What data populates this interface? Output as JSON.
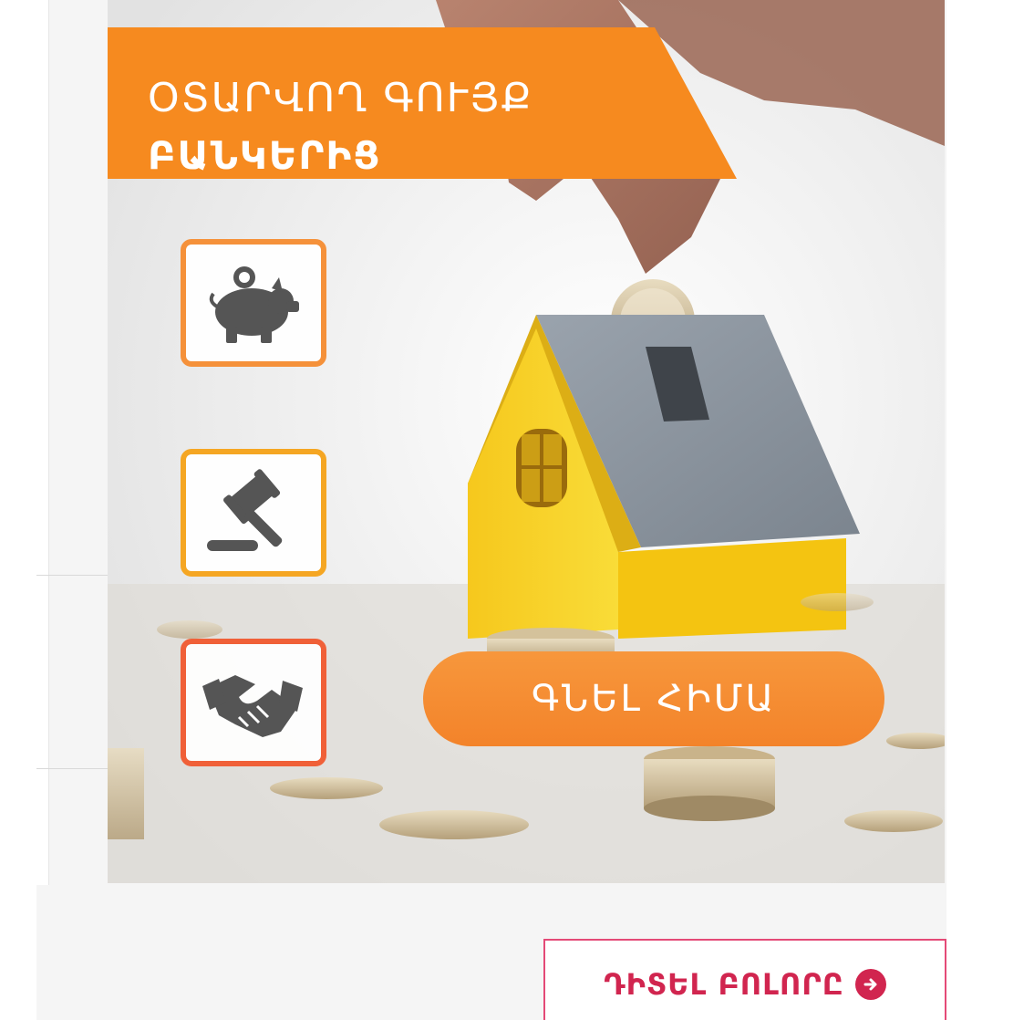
{
  "banner": {
    "headline_line1": "ՕՏԱՐՎՈՂ ԳՈՒՅՔ",
    "headline_line2": "ԲԱՆԿԵՐԻՑ",
    "features": [
      {
        "icon": "piggy-bank-icon",
        "color": "#f5913a"
      },
      {
        "icon": "gavel-icon",
        "color": "#f5a623"
      },
      {
        "icon": "handshake-icon",
        "color": "#f06038"
      }
    ],
    "cta_label": "ԳՆԵԼ ՀԻՄԱ",
    "ribbon_color": "#f68a1f"
  },
  "footer": {
    "see_all_label": "ԴԻՏԵԼ ԲՈԼՈՐԸ",
    "see_all_icon": "arrow-circle-right-icon",
    "accent": "#d1254f"
  }
}
